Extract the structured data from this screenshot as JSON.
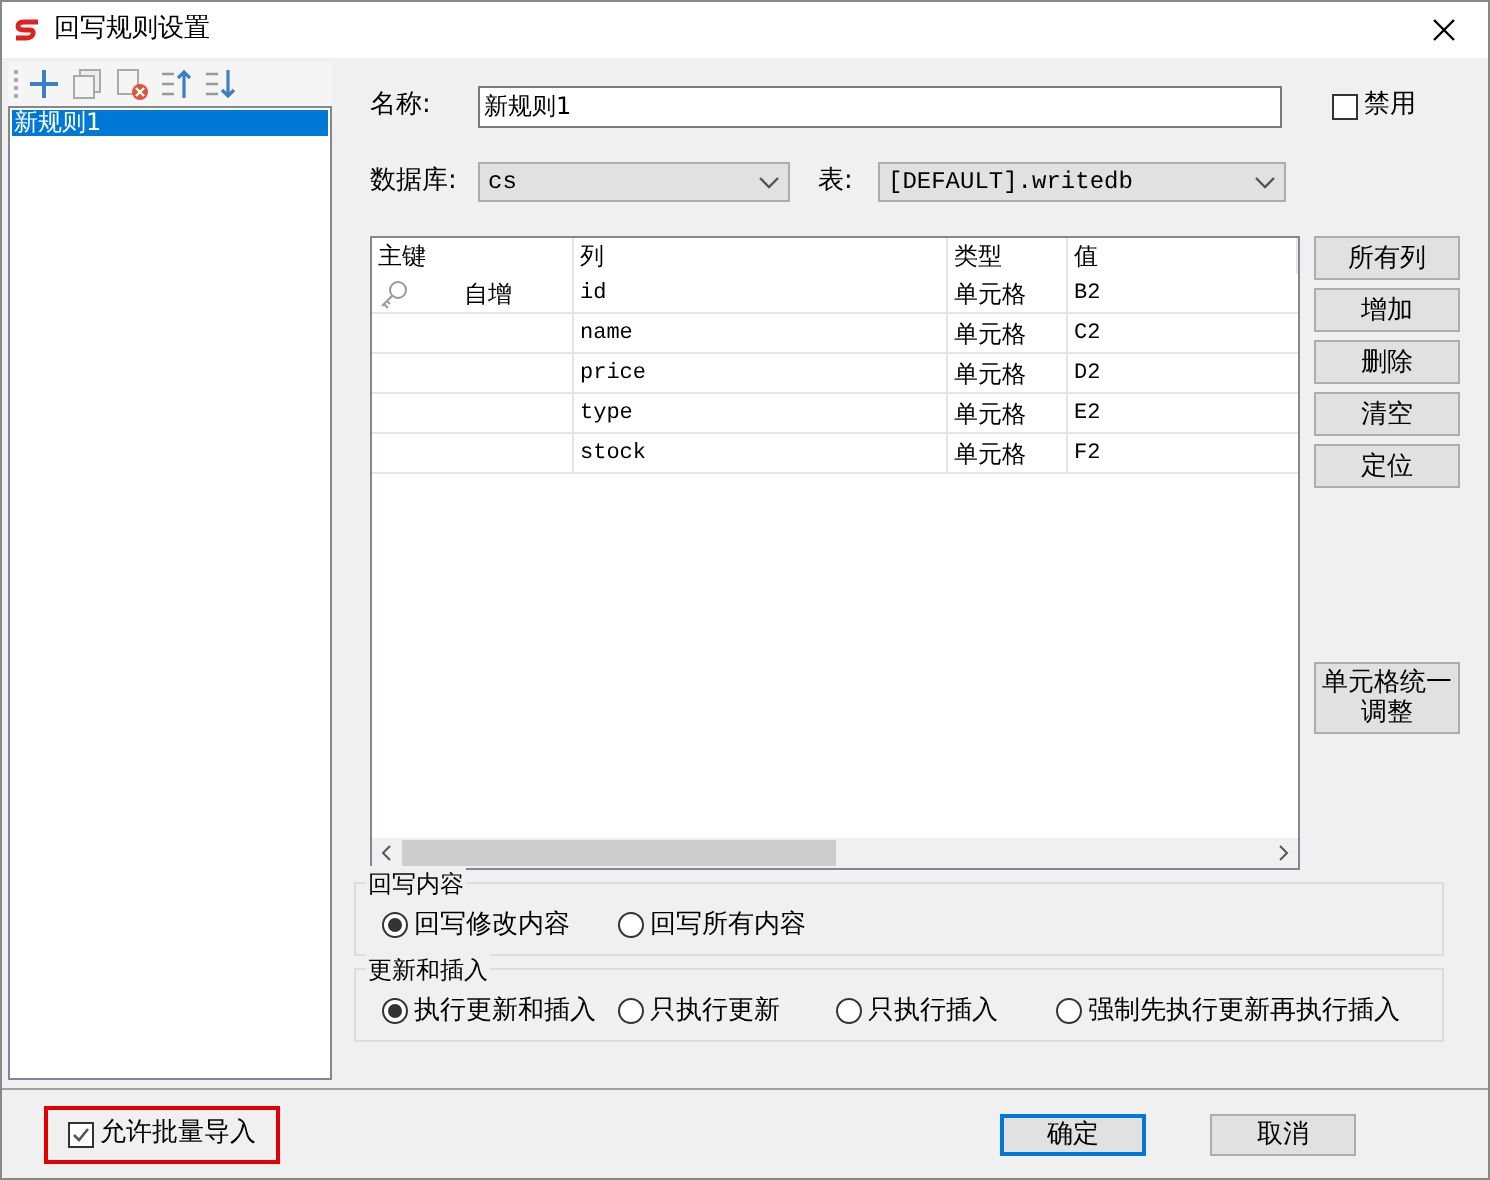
{
  "window": {
    "title": "回写规则设置"
  },
  "rules": [
    {
      "label": "新规则1",
      "selected": true
    }
  ],
  "name_field": {
    "label": "名称:",
    "value": "新规则1"
  },
  "disable_checkbox": {
    "label": "禁用",
    "checked": false
  },
  "database": {
    "label": "数据库:",
    "value": "cs"
  },
  "table_select": {
    "label": "表:",
    "value": "[DEFAULT].writedb"
  },
  "table": {
    "columns": [
      "主键",
      "列",
      "类型",
      "值"
    ],
    "rows": [
      {
        "primary_key": true,
        "auto_increment": "自增",
        "column": "id",
        "type": "单元格",
        "value": "B2"
      },
      {
        "primary_key": false,
        "column": "name",
        "type": "单元格",
        "value": "C2"
      },
      {
        "primary_key": false,
        "column": "price",
        "type": "单元格",
        "value": "D2"
      },
      {
        "primary_key": false,
        "column": "type",
        "type": "单元格",
        "value": "E2"
      },
      {
        "primary_key": false,
        "column": "stock",
        "type": "单元格",
        "value": "F2"
      }
    ]
  },
  "side_buttons": [
    "所有列",
    "增加",
    "删除",
    "清空",
    "定位"
  ],
  "cell_adjust_button": "单元格统一调整",
  "writeback_group": {
    "title": "回写内容",
    "options": [
      {
        "label": "回写修改内容",
        "selected": true
      },
      {
        "label": "回写所有内容",
        "selected": false
      }
    ]
  },
  "update_group": {
    "title": "更新和插入",
    "options": [
      {
        "label": "执行更新和插入",
        "selected": true
      },
      {
        "label": "只执行更新",
        "selected": false
      },
      {
        "label": "只执行插入",
        "selected": false
      },
      {
        "label": "强制先执行更新再执行插入",
        "selected": false
      }
    ]
  },
  "batch_import": {
    "label": "允许批量导入",
    "checked": true,
    "highlighted": true
  },
  "footer_buttons": [
    {
      "label": "确定",
      "default": true
    },
    {
      "label": "取消",
      "default": false
    }
  ]
}
